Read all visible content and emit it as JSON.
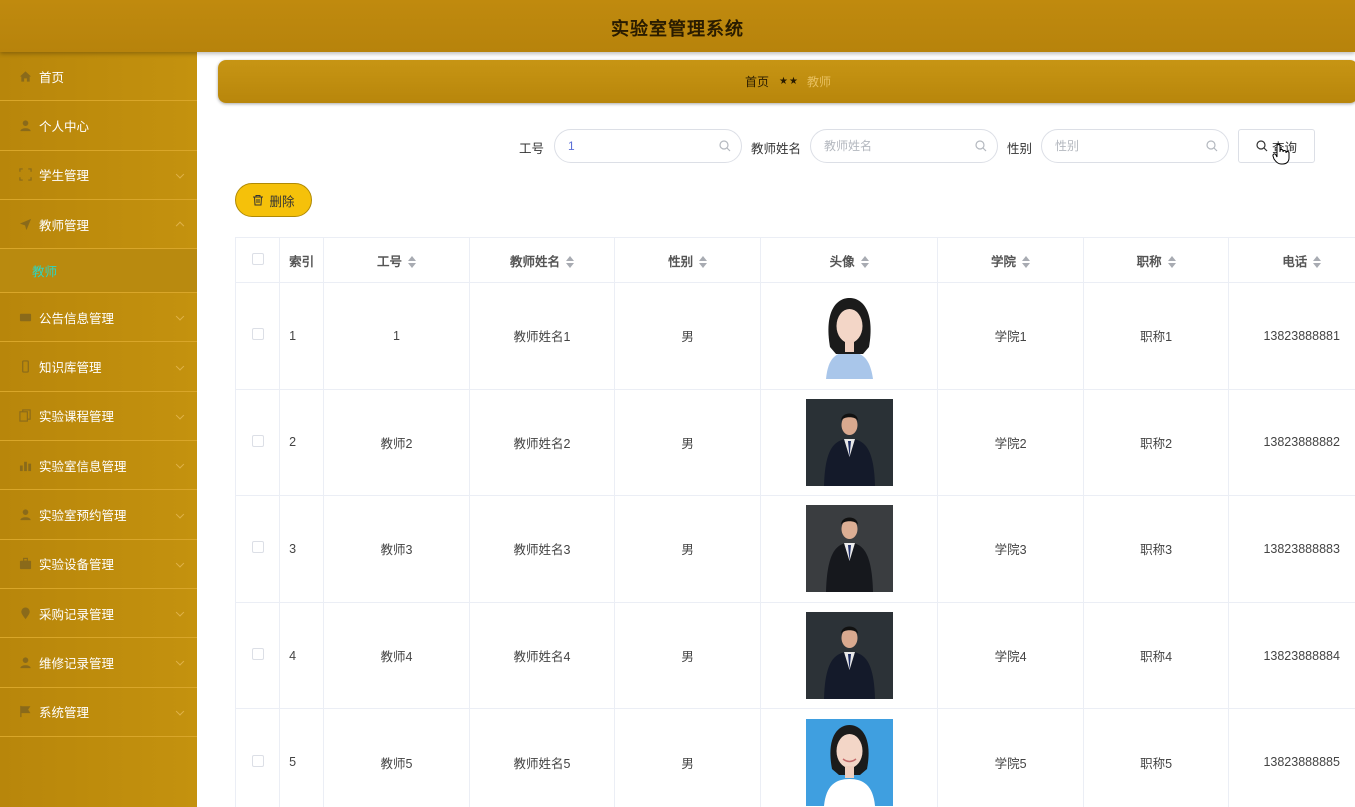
{
  "app": {
    "title": "实验室管理系统"
  },
  "sidebar": {
    "items": [
      {
        "label": "首页",
        "icon": "home-icon"
      },
      {
        "label": "个人中心",
        "icon": "user-icon"
      },
      {
        "label": "学生管理",
        "icon": "frame-icon"
      },
      {
        "label": "教师管理",
        "icon": "send-icon"
      },
      {
        "label": "公告信息管理",
        "icon": "card-icon"
      },
      {
        "label": "知识库管理",
        "icon": "phone-icon"
      },
      {
        "label": "实验课程管理",
        "icon": "copy-icon"
      },
      {
        "label": "实验室信息管理",
        "icon": "bar-chart-icon"
      },
      {
        "label": "实验室预约管理",
        "icon": "user-icon"
      },
      {
        "label": "实验设备管理",
        "icon": "briefcase-icon"
      },
      {
        "label": "采购记录管理",
        "icon": "location-icon"
      },
      {
        "label": "维修记录管理",
        "icon": "user-icon"
      },
      {
        "label": "系统管理",
        "icon": "flag-icon"
      }
    ],
    "submenu": {
      "label": "教师"
    }
  },
  "breadcrumb": {
    "home": "首页",
    "sep": "★★",
    "current": "教师"
  },
  "search": {
    "id_label": "工号",
    "id_value": "1",
    "id_placeholder": "工号",
    "name_label": "教师姓名",
    "name_placeholder": "教师姓名",
    "gender_label": "性别",
    "gender_placeholder": "性别",
    "query_label": "查询"
  },
  "actions": {
    "delete_label": "删除"
  },
  "table": {
    "headers": [
      "索引",
      "工号",
      "教师姓名",
      "性别",
      "头像",
      "学院",
      "职称",
      "电话"
    ],
    "rows": [
      {
        "index": "1",
        "id": "1",
        "name": "教师姓名1",
        "gender": "男",
        "avatar": "female-portrait",
        "college": "学院1",
        "title": "职称1",
        "phone": "13823888881"
      },
      {
        "index": "2",
        "id": "教师2",
        "name": "教师姓名2",
        "gender": "男",
        "avatar": "male-portrait",
        "college": "学院2",
        "title": "职称2",
        "phone": "13823888882"
      },
      {
        "index": "3",
        "id": "教师3",
        "name": "教师姓名3",
        "gender": "男",
        "avatar": "male-portrait",
        "college": "学院3",
        "title": "职称3",
        "phone": "13823888883"
      },
      {
        "index": "4",
        "id": "教师4",
        "name": "教师姓名4",
        "gender": "男",
        "avatar": "male-portrait",
        "college": "学院4",
        "title": "职称4",
        "phone": "13823888884"
      },
      {
        "index": "5",
        "id": "教师5",
        "name": "教师姓名5",
        "gender": "男",
        "avatar": "female-portrait",
        "college": "学院5",
        "title": "职称5",
        "phone": "13823888885"
      }
    ]
  },
  "colors": {
    "brand": "#b8860b",
    "delete_button": "#f5c10a",
    "active_submenu": "#2bd7c4"
  }
}
